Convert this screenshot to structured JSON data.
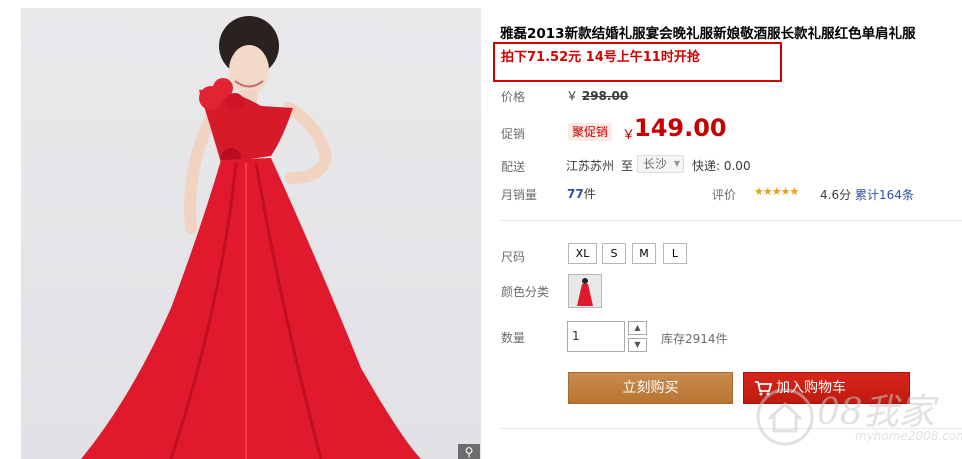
{
  "product": {
    "title": "雅磊2013新款结婚礼服宴会晚礼服新娘敬酒服长款礼服红色单肩礼服",
    "promo_note": "拍下71.52元 14号上午11时开抢"
  },
  "price": {
    "label": "价格",
    "original_prefix": "￥",
    "original": "298.00"
  },
  "promotion": {
    "label": "促销",
    "badge": "聚促销",
    "currency": "￥",
    "value": "149.00"
  },
  "shipping": {
    "label": "配送",
    "from": "江苏苏州",
    "to_word": "至",
    "to_city": "长沙",
    "express": "快递: 0.00"
  },
  "sales": {
    "label": "月销量",
    "count": "77",
    "unit": "件"
  },
  "rating": {
    "label": "评价",
    "stars": "★★★★★",
    "score": "4.6分",
    "reviews": "累计164条"
  },
  "size": {
    "label": "尺码",
    "options": [
      "XL",
      "S",
      "M",
      "L"
    ]
  },
  "color": {
    "label": "颜色分类"
  },
  "quantity": {
    "label": "数量",
    "value": "1",
    "stock": "库存2914件"
  },
  "actions": {
    "buy_now": "立刻购买",
    "add_to_cart": "加入购物车"
  },
  "watermark": {
    "text": "08我家",
    "url": "myhome2008.com"
  },
  "icons": {
    "zoom": "magnifier-icon",
    "cart": "cart-icon",
    "logo": "house-logo-icon"
  },
  "colors": {
    "accent_red": "#c40000",
    "promo_border": "#d40000",
    "link_blue": "#2953a6",
    "buy_button": "#b87532",
    "cart_button": "#c01a10"
  }
}
